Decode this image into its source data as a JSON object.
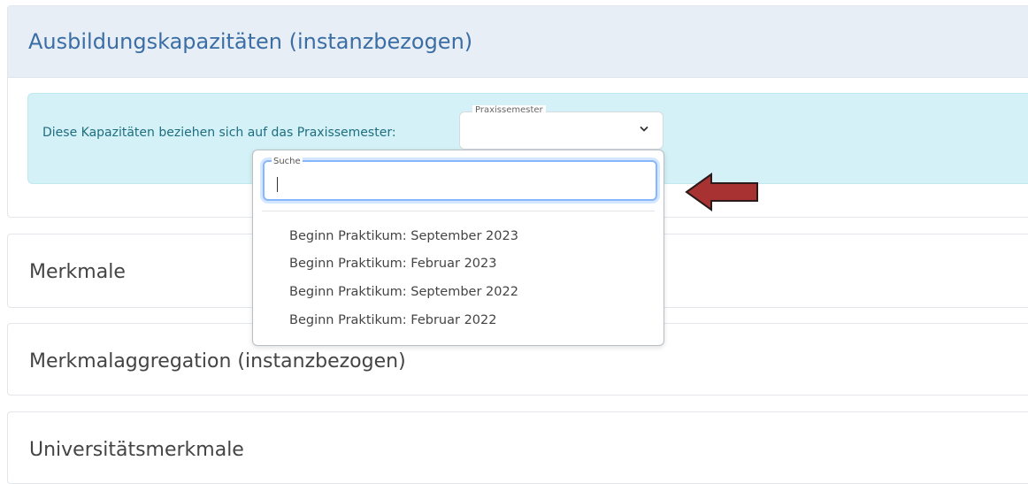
{
  "capacity_card": {
    "title": "Ausbildungskapazitäten (instanzbezogen)",
    "info_text": "Diese Kapazitäten beziehen sich auf das Praxissemester:",
    "select": {
      "label": "Praxissemester",
      "value": ""
    }
  },
  "dropdown": {
    "search_label": "Suche",
    "search_value": "",
    "options": [
      "Beginn Praktikum: September 2023",
      "Beginn Praktikum: Februar 2023",
      "Beginn Praktikum: September 2022",
      "Beginn Praktikum: Februar 2022"
    ]
  },
  "sections": [
    {
      "title": "Merkmale"
    },
    {
      "title": "Merkmalaggregation (instanzbezogen)"
    },
    {
      "title": "Universitätsmerkmale"
    }
  ],
  "colors": {
    "header_bg": "#e8eef5",
    "title_blue": "#3a6ea5",
    "alert_bg": "#d3f1f6",
    "alert_text": "#1e6e80",
    "focus_blue": "#86b7fe",
    "arrow_fill": "#a83232"
  },
  "icons": {
    "select_chevron": "chevron-down-icon",
    "pointer_arrow": "left-arrow-icon"
  }
}
